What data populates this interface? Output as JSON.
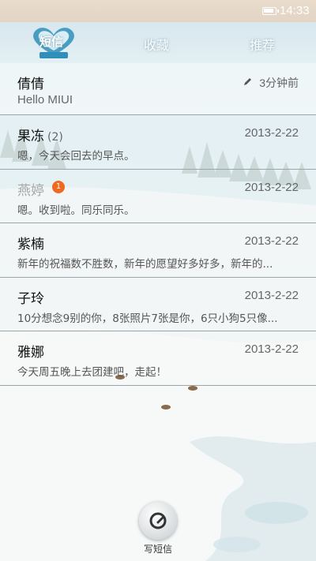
{
  "status_bar": {
    "time": "14:33",
    "battery_icon": "battery-icon"
  },
  "header": {
    "logo_text": "短信",
    "tabs": [
      {
        "label": "收藏"
      },
      {
        "label": "推荐"
      }
    ]
  },
  "messages": [
    {
      "name": "倩倩",
      "preview": "Hello MIUI",
      "time": "3分钟前",
      "draft": true
    },
    {
      "name": "果冻",
      "count": "(2)",
      "preview": "嗯，今天会回去的早点。",
      "time": "2013-2-22"
    },
    {
      "name": "燕婷",
      "badge": "1",
      "preview": "嗯。收到啦。同乐同乐。",
      "time": "2013-2-22",
      "read": true
    },
    {
      "name": "紫楠",
      "preview": "新年的祝福数不胜数，新年的愿望好多好多，新年的...",
      "time": "2013-2-22"
    },
    {
      "name": "子玲",
      "preview": "10分想念9别的你，8张照片7张是你，6只小狗5只像...",
      "time": "2013-2-22"
    },
    {
      "name": "雅娜",
      "preview": "今天周五晚上去团建吧，走起！",
      "time": "2013-2-22"
    }
  ],
  "compose": {
    "label": "写短信"
  },
  "colors": {
    "badge": "#ef6a1f",
    "divider": "#9aa6aa"
  }
}
